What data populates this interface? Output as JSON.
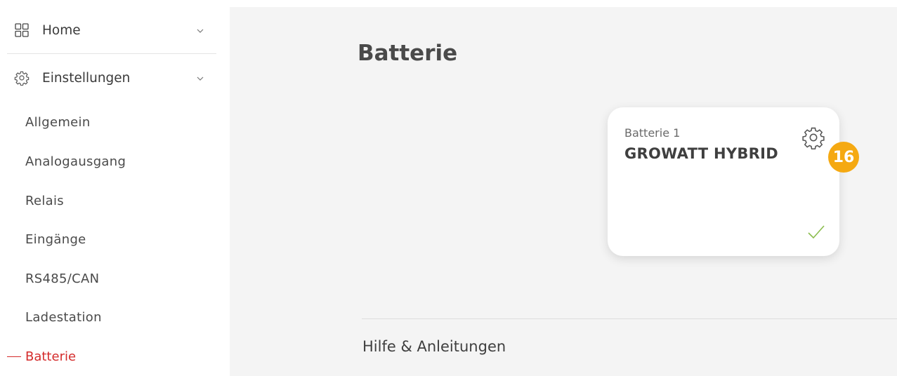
{
  "sidebar": {
    "home_label": "Home",
    "settings_label": "Einstellungen",
    "items": [
      {
        "label": "Allgemein"
      },
      {
        "label": "Analogausgang"
      },
      {
        "label": "Relais"
      },
      {
        "label": "Eingänge"
      },
      {
        "label": "RS485/CAN"
      },
      {
        "label": "Ladestation"
      }
    ],
    "active_item": "Batterie",
    "active_color": "#d42b2b"
  },
  "main": {
    "title": "Batterie",
    "card": {
      "subtitle": "Batterie 1",
      "name": "GROWATT HYBRID",
      "gear_icon": "gear-icon",
      "status_icon": "check-icon",
      "status_color": "#8bbd4e"
    },
    "badge": "16",
    "badge_color": "#f5a912",
    "help_label": "Hilfe & Anleitungen"
  }
}
